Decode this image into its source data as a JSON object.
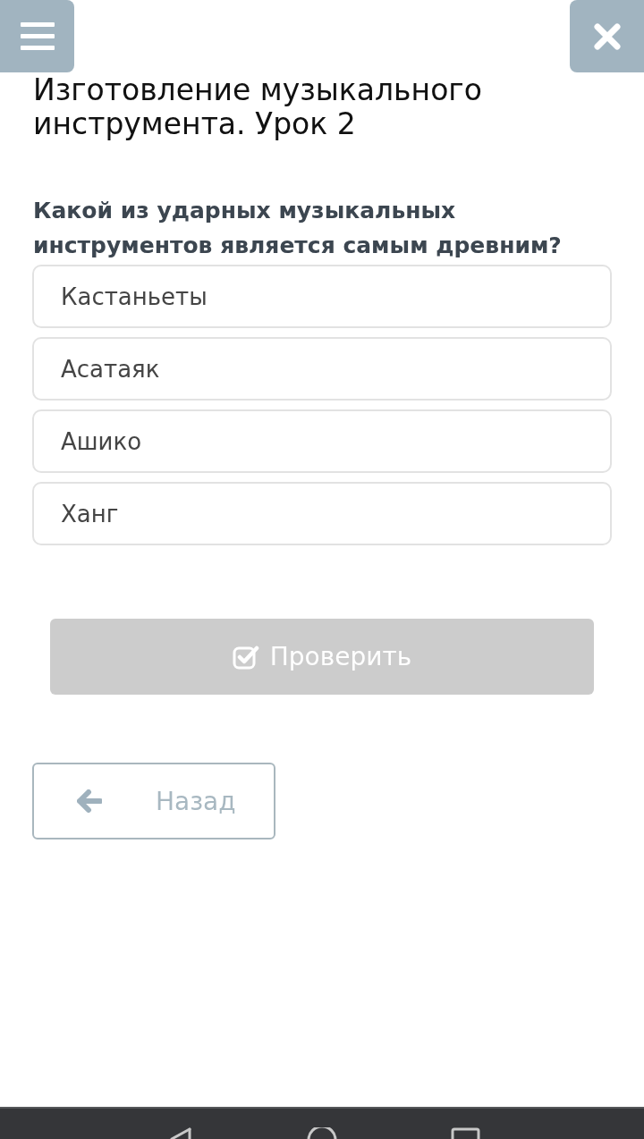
{
  "lesson_title": "Изготовление музыкального инструмента. Урок 2",
  "question": "Какой из ударных музыкальных инструментов является самым древним?",
  "options": [
    {
      "label": "Кастаньеты",
      "selected": false
    },
    {
      "label": "Асатаяк",
      "selected": false
    },
    {
      "label": "Ашико",
      "selected": false
    },
    {
      "label": "Ханг",
      "selected": false
    }
  ],
  "check_button": {
    "label": "Проверить",
    "disabled": true
  },
  "back_button": {
    "label": "Назад"
  }
}
